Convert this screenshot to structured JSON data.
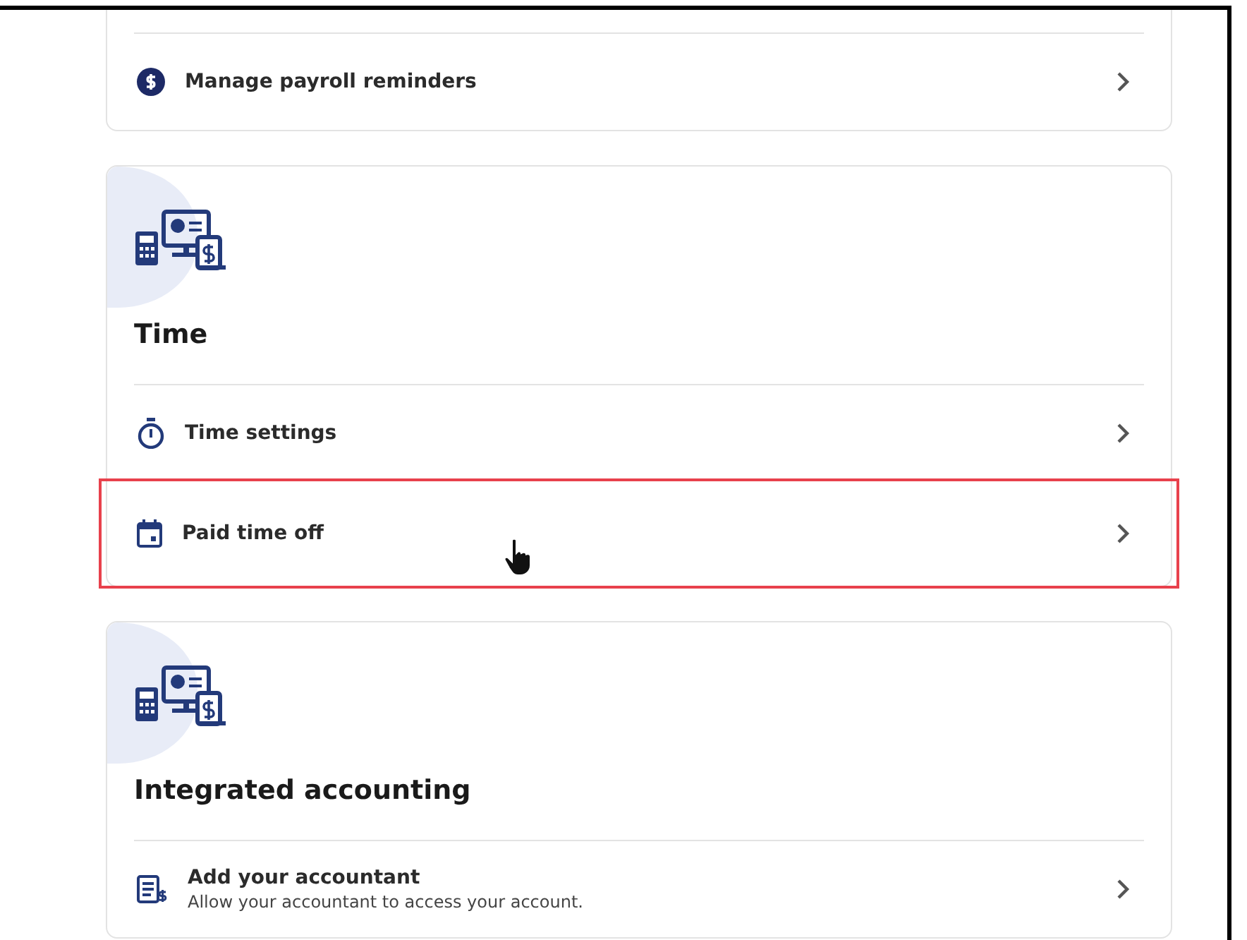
{
  "sections": [
    {
      "items": [
        {
          "label": "Manage payroll reminders",
          "highlighted": false
        }
      ]
    },
    {
      "title": "Time",
      "items": [
        {
          "label": "Time settings",
          "highlighted": false
        },
        {
          "label": "Paid time off",
          "highlighted": true
        }
      ]
    },
    {
      "title": "Integrated accounting",
      "items": [
        {
          "label": "Add your accountant",
          "description": "Allow your accountant to access your account.",
          "highlighted": false
        }
      ]
    }
  ]
}
